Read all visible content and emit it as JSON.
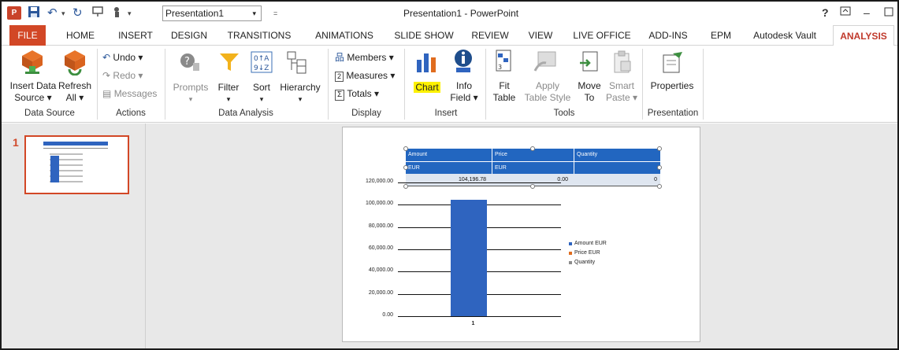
{
  "window": {
    "document_selector": "Presentation1",
    "title": "Presentation1 - PowerPoint"
  },
  "tabs": [
    {
      "label": "FILE"
    },
    {
      "label": "HOME"
    },
    {
      "label": "INSERT"
    },
    {
      "label": "DESIGN"
    },
    {
      "label": "TRANSITIONS"
    },
    {
      "label": "ANIMATIONS"
    },
    {
      "label": "SLIDE SHOW"
    },
    {
      "label": "REVIEW"
    },
    {
      "label": "VIEW"
    },
    {
      "label": "LIVE OFFICE"
    },
    {
      "label": "ADD-INS"
    },
    {
      "label": "EPM"
    },
    {
      "label": "Autodesk Vault"
    },
    {
      "label": "ANALYSIS"
    }
  ],
  "active_tab": "ANALYSIS",
  "ribbon": {
    "data_source": {
      "label": "Data Source",
      "insert_line1": "Insert Data",
      "insert_line2": "Source ▾",
      "refresh_line1": "Refresh",
      "refresh_line2": "All ▾"
    },
    "actions": {
      "label": "Actions",
      "undo": "Undo ▾",
      "redo": "Redo ▾",
      "messages": "Messages"
    },
    "data_analysis": {
      "label": "Data Analysis",
      "prompts": "Prompts",
      "filter": "Filter",
      "sort": "Sort",
      "hierarchy": "Hierarchy"
    },
    "display": {
      "label": "Display",
      "members": "Members ▾",
      "measures": "Measures ▾",
      "totals": "Totals ▾"
    },
    "insert": {
      "label": "Insert",
      "chart": "Chart",
      "info_line1": "Info",
      "info_line2": "Field ▾"
    },
    "tools": {
      "label": "Tools",
      "fit_line1": "Fit",
      "fit_line2": "Table",
      "apply_line1": "Apply",
      "apply_line2": "Table Style",
      "move_line1": "Move",
      "move_line2": "To",
      "smart_line1": "Smart",
      "smart_line2": "Paste ▾"
    },
    "presentation": {
      "label": "Presentation",
      "properties": "Properties"
    }
  },
  "slide_panel": {
    "slide_number": "1"
  },
  "slide": {
    "table": {
      "headers": [
        "Amount",
        "Price",
        "Quantity"
      ],
      "units": [
        "EUR",
        "EUR",
        ""
      ],
      "values": [
        "104,196.78",
        "0.00",
        "0"
      ]
    }
  },
  "chart_data": {
    "type": "bar",
    "categories": [
      "1"
    ],
    "series": [
      {
        "name": "Amount EUR",
        "values": [
          104196.78
        ]
      },
      {
        "name": "Price EUR",
        "values": [
          0
        ]
      },
      {
        "name": "Quantity",
        "values": [
          0
        ]
      }
    ],
    "y_tick_labels": [
      "120,000.00",
      "100,000.00",
      "80,000.00",
      "60,000.00",
      "40,000.00",
      "20,000.00",
      "0.00"
    ],
    "ylim": [
      0,
      120000
    ],
    "legend_position": "right",
    "colors": {
      "Amount EUR": "#2f64bf",
      "Price EUR": "#e06c1f",
      "Quantity": "#8c8c8c"
    }
  },
  "colors": {
    "file_tab": "#d24726",
    "active_tab_text": "#c0392b",
    "table_header": "#2266c0",
    "selection_border": "#d24726",
    "highlight": "#fdf100"
  }
}
